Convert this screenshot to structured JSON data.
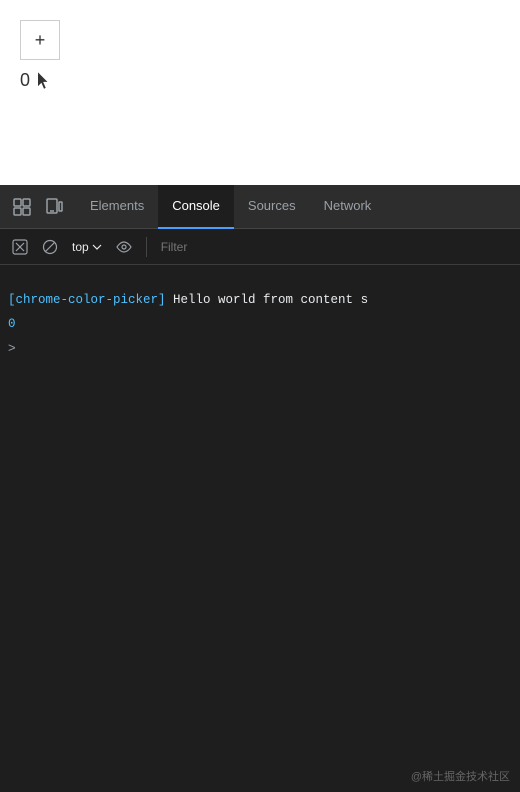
{
  "browser": {
    "plus_label": "+",
    "counter_value": "0"
  },
  "devtools": {
    "tabs": [
      {
        "id": "elements",
        "label": "Elements",
        "active": false
      },
      {
        "id": "console",
        "label": "Console",
        "active": true
      },
      {
        "id": "sources",
        "label": "Sources",
        "active": false
      },
      {
        "id": "network",
        "label": "Network",
        "active": false
      }
    ],
    "toolbar": {
      "context_selector": "top",
      "filter_placeholder": "Filter"
    },
    "console_output": [
      {
        "type": "log",
        "prefix": "[chrome-color-picker]",
        "text": " Hello world from content s"
      }
    ],
    "console_number": "0",
    "caret": ">"
  },
  "watermark": {
    "text": "@稀土掘金技术社区"
  },
  "icons": {
    "inspect": "⊡",
    "device": "⊞",
    "clear": "🚫",
    "eye": "👁",
    "chevron_down": "▾"
  }
}
